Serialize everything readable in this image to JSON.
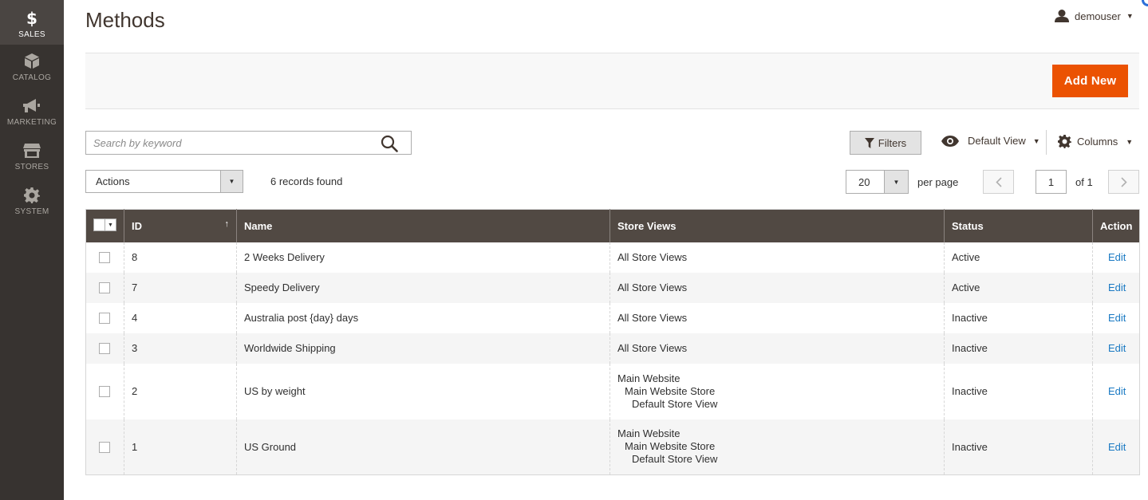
{
  "sidebar": {
    "items": [
      {
        "label": "SALES",
        "icon": "dollar-icon",
        "glyph": "$",
        "active": true
      },
      {
        "label": "CATALOG",
        "icon": "cube-icon"
      },
      {
        "label": "MARKETING",
        "icon": "megaphone-icon"
      },
      {
        "label": "STORES",
        "icon": "store-icon"
      },
      {
        "label": "SYSTEM",
        "icon": "gear-icon"
      }
    ]
  },
  "header": {
    "title": "Methods",
    "user": {
      "name": "demouser",
      "caret": "▼"
    }
  },
  "action_bar": {
    "add_new_label": "Add New"
  },
  "toolbar": {
    "search_placeholder": "Search by keyword",
    "filters_label": "Filters",
    "view_label": "Default View",
    "columns_label": "Columns",
    "caret": "▼",
    "actions_label": "Actions",
    "records_found": "6 records found",
    "per_page_value": "20",
    "per_page_label": "per page",
    "current_page": "1",
    "page_total": "of 1"
  },
  "grid": {
    "columns": {
      "id": "ID",
      "name": "Name",
      "store_views": "Store Views",
      "status": "Status",
      "action": "Action"
    },
    "sort_arrow": "↑",
    "rows": [
      {
        "id": "8",
        "name": "2 Weeks Delivery",
        "stores": [
          "All Store Views"
        ],
        "status": "Active",
        "action": "Edit"
      },
      {
        "id": "7",
        "name": "Speedy Delivery",
        "stores": [
          "All Store Views"
        ],
        "status": "Active",
        "action": "Edit"
      },
      {
        "id": "4",
        "name": "Australia post {day} days",
        "stores": [
          "All Store Views"
        ],
        "status": "Inactive",
        "action": "Edit"
      },
      {
        "id": "3",
        "name": "Worldwide Shipping",
        "stores": [
          "All Store Views"
        ],
        "status": "Inactive",
        "action": "Edit"
      },
      {
        "id": "2",
        "name": "US by weight",
        "stores": [
          "Main Website",
          "Main Website Store",
          "Default Store View"
        ],
        "status": "Inactive",
        "action": "Edit"
      },
      {
        "id": "1",
        "name": "US Ground",
        "stores": [
          "Main Website",
          "Main Website Store",
          "Default Store View"
        ],
        "status": "Inactive",
        "action": "Edit"
      }
    ]
  },
  "colors": {
    "accent": "#eb5202",
    "header_bg": "#514943",
    "sidebar_bg": "#373330",
    "link": "#1979c3"
  }
}
